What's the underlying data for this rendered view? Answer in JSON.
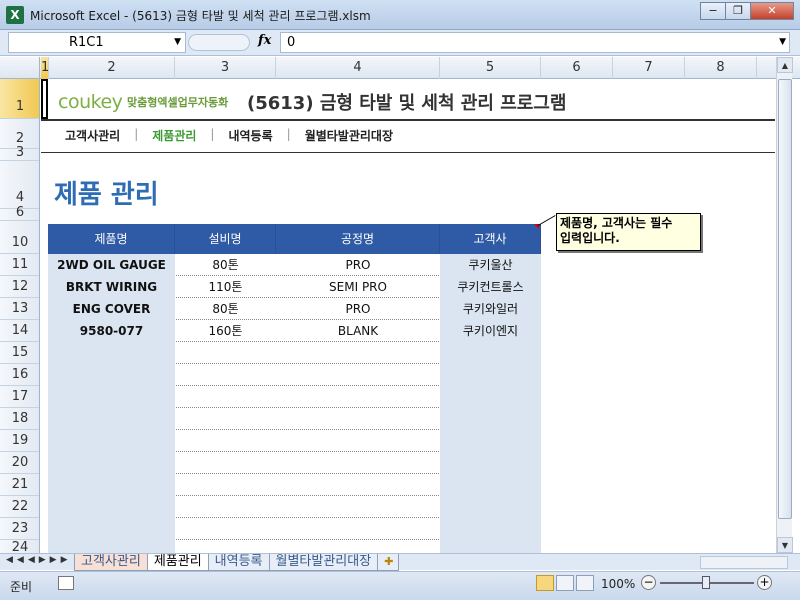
{
  "window": {
    "app_icon": "X",
    "title": "Microsoft Excel - (5613) 금형 타발 및 세척 관리 프로그램.xlsm",
    "buttons": {
      "minimize": "−",
      "restore": "❐",
      "close": "✕"
    }
  },
  "formula_bar": {
    "name_box": "R1C1",
    "fx": "fx",
    "value": "0"
  },
  "columns": [
    "1",
    "2",
    "3",
    "4",
    "5",
    "6",
    "7",
    "8"
  ],
  "rows": [
    "1",
    "2",
    "3",
    "4",
    "6",
    "10",
    "11",
    "12",
    "13",
    "14",
    "15",
    "16",
    "17",
    "18",
    "19",
    "20",
    "21",
    "22",
    "23",
    "24"
  ],
  "header": {
    "logo": "coukey",
    "logo_sub": "맞춤형엑셀업무자동화",
    "program_title": "(5613) 금형 타발 및 세척 관리 프로그램"
  },
  "nav": {
    "items": [
      "고객사관리",
      "제품관리",
      "내역등록",
      "월별타발관리대장"
    ],
    "separator": "|",
    "active_index": 1
  },
  "page_title": "제품 관리",
  "table": {
    "headers": [
      "제품명",
      "설비명",
      "공정명",
      "고객사"
    ],
    "rows": [
      [
        "2WD OIL GAUGE",
        "80톤",
        "PRO",
        "쿠키울산"
      ],
      [
        "BRKT WIRING",
        "110톤",
        "SEMI PRO",
        "쿠키컨트롤스"
      ],
      [
        "ENG COVER",
        "80톤",
        "PRO",
        "쿠키와일러"
      ],
      [
        "9580-077",
        "160톤",
        "BLANK",
        "쿠키이엔지"
      ],
      [
        "",
        "",
        "",
        ""
      ],
      [
        "",
        "",
        "",
        ""
      ],
      [
        "",
        "",
        "",
        ""
      ],
      [
        "",
        "",
        "",
        ""
      ],
      [
        "",
        "",
        "",
        ""
      ],
      [
        "",
        "",
        "",
        ""
      ],
      [
        "",
        "",
        "",
        ""
      ],
      [
        "",
        "",
        "",
        ""
      ],
      [
        "",
        "",
        "",
        ""
      ],
      [
        "",
        "",
        "",
        ""
      ]
    ]
  },
  "comment": {
    "line1": "제품명, 고객사는 필수",
    "line2": "입력입니다."
  },
  "sheet_tabs": [
    "고객사관리",
    "제품관리",
    "내역등록",
    "월별타발관리대장"
  ],
  "status": {
    "ready": "준비",
    "zoom": "100%"
  }
}
